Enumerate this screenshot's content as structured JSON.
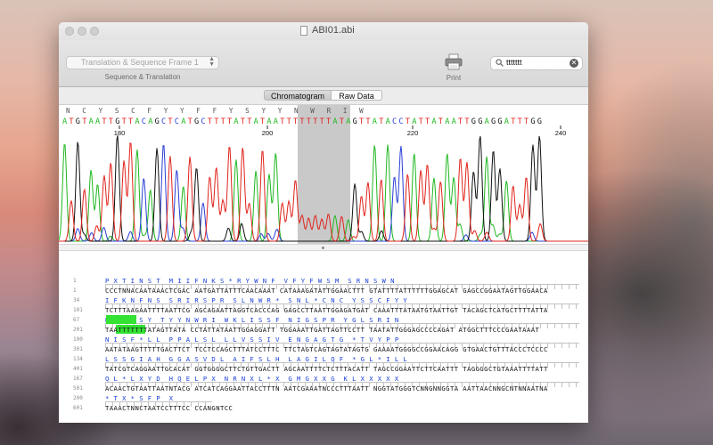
{
  "window": {
    "title": "ABI01.abi"
  },
  "toolbar": {
    "frame_select": "Translation & Sequence Frame 1",
    "frame_caption": "Sequence & Translation",
    "print_label": "Print",
    "search_value": "ttttttt"
  },
  "tabs": [
    {
      "label": "Chromatogram",
      "selected": true
    },
    {
      "label": "Raw Data",
      "selected": false
    }
  ],
  "chromatogram": {
    "bases": "ATGTAATTGTTACAGCTCATGCTTTTATTATAATTTTTTTTATAGTTATACCTATTATAATTGGAGGATTTGG",
    "aa_row": "N   C   Y   S   C   F   Y   Y   F   F   Y   S   Y   Y   N   W   R   I   W",
    "positions": [
      "180",
      "200",
      "220",
      "240"
    ],
    "highlight_range": "Y F F",
    "colors": {
      "A": "#1fb81f",
      "C": "#2a3fd6",
      "G": "#111111",
      "T": "#e0231b"
    }
  },
  "sequence": {
    "rows": [
      {
        "aa_num": "1",
        "aa": "P X T I N S T  M I I F N K S * R Y W N F  V F Y F W S M  S R N S W N",
        "dna_num": "1",
        "dna": "CCCTNNACAATAAACTCGAC AATGATTATTTCAACAAAT CATAAAGATATTGGAACTTT GTATTTTATTTTTTGGAGCAT GAGCCGGAATAGTTGGAACA"
      },
      {
        "aa_num": "34",
        "aa": "I F K N F N S  S R I R S P R  S L N W R *  S N L * C N C  Y S S C F Y Y",
        "dna_num": "101",
        "dna": "TCTTTAAGAATTTTAATTCG AGCAGAATTAGGTCACCCAG GAGCCTTAATTGGAGATGAT CAAATTTATAATGTAATTGT TACAGCTCATGCTTTTATTA"
      },
      {
        "aa_num": "67",
        "aa": "N F F Y S Y  T Y Y N W R I  W K L I S S F  N I G S P R  Y G L S R I N",
        "dna_num": "201",
        "dna": "TAATTTTTTTATAGTTATA CCTATTATAATTGGAGGATT TGGAAATTGATTAGTTCCTT TAATATTGGGAGCCCCAGAT ATGGCTTTCCCGAATAAAT"
      },
      {
        "aa_num": "100",
        "aa": "N I S F * L L  P P A L S L  L L V S S I V  E N G A G T G  * T V Y P P",
        "dna_num": "301",
        "dna": "AATATAAGTTTTTGACTTCT TCCTCCAGCTTTATCCTTTC TTCTAGTCAGTAGTATAGTG GAAAATGGGGCCGGAACAGG GTGAACTGTTTACCCTCCCC"
      },
      {
        "aa_num": "134",
        "aa": "L S S G I A H  G G A S V D L  A I F S L H  L A G I L Q F  * G L * I L L",
        "dna_num": "401",
        "dna": "TATCGTCAGGAATTGCACAT GGTGGGGCTTCTGTTGACTT AGCAATTTTCTCTTTACATT TAGCCGGAATTCTTCAATTT TAGGGGCTGTAAATTTTATT"
      },
      {
        "aa_num": "167",
        "aa": "Q L * L X Y D  H Q E L P X  N R N X L * X  G M G X X G  K L X X X X X",
        "dna_num": "501",
        "dna": "ACAACTGTAATTAATNTACG ATCATCAGGAATTACCTTTN AATCGAAATNCCCTTTAATT NGGTATGGGTCNNGNNGGTA AATTAACNNGCNTNNAATNA"
      },
      {
        "aa_num": "200",
        "aa": "* T X * S F P  X",
        "dna_num": "601",
        "dna": "TAAACTNNCTAATCCTTTCC CCANGNTCC"
      }
    ]
  }
}
